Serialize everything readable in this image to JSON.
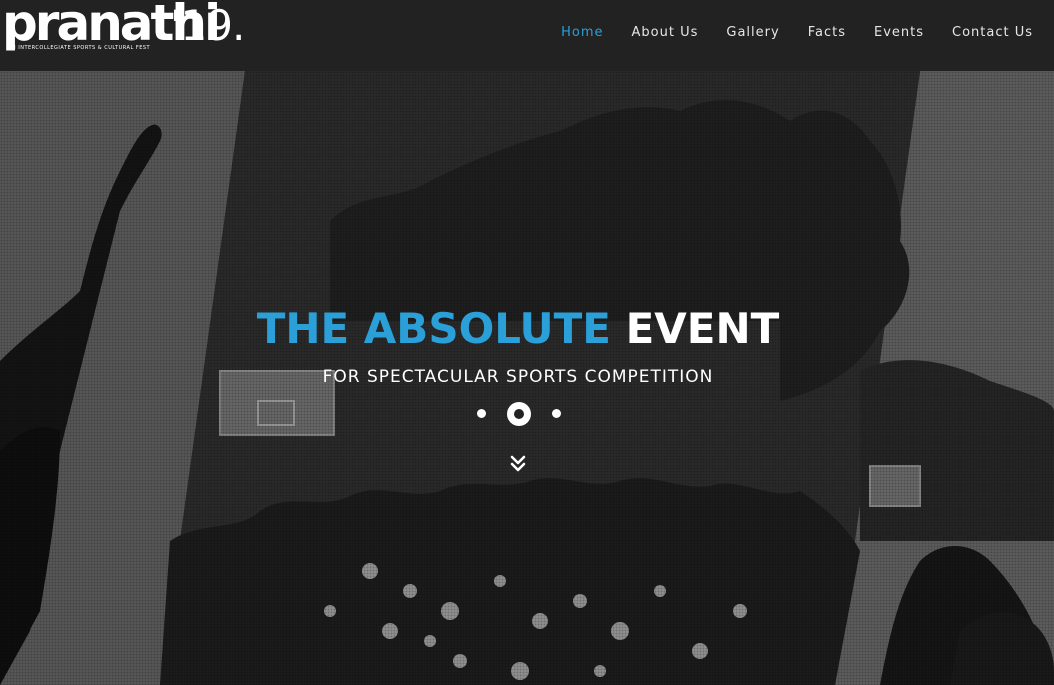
{
  "brand": {
    "logo_word": "pranathi",
    "logo_year": "'19.",
    "tagline": "AN INTERCOLLEGIATE SPORTS & CULTURAL FEST"
  },
  "nav": {
    "items": [
      {
        "label": "Home",
        "active": true
      },
      {
        "label": "About Us",
        "active": false
      },
      {
        "label": "Gallery",
        "active": false
      },
      {
        "label": "Facts",
        "active": false
      },
      {
        "label": "Events",
        "active": false
      },
      {
        "label": "Contact Us",
        "active": false
      }
    ]
  },
  "hero": {
    "title_accent": "THE ABSOLUTE",
    "title_plain": "EVENT",
    "subtitle": "FOR SPECTACULAR SPORTS COMPETITION",
    "slides": {
      "count": 3,
      "active_index": 2
    },
    "scroll_icon": "double-chevron-down-icon"
  },
  "colors": {
    "accent": "#2a9fd8",
    "nav_bg": "#222222",
    "text_light": "#ffffff"
  }
}
